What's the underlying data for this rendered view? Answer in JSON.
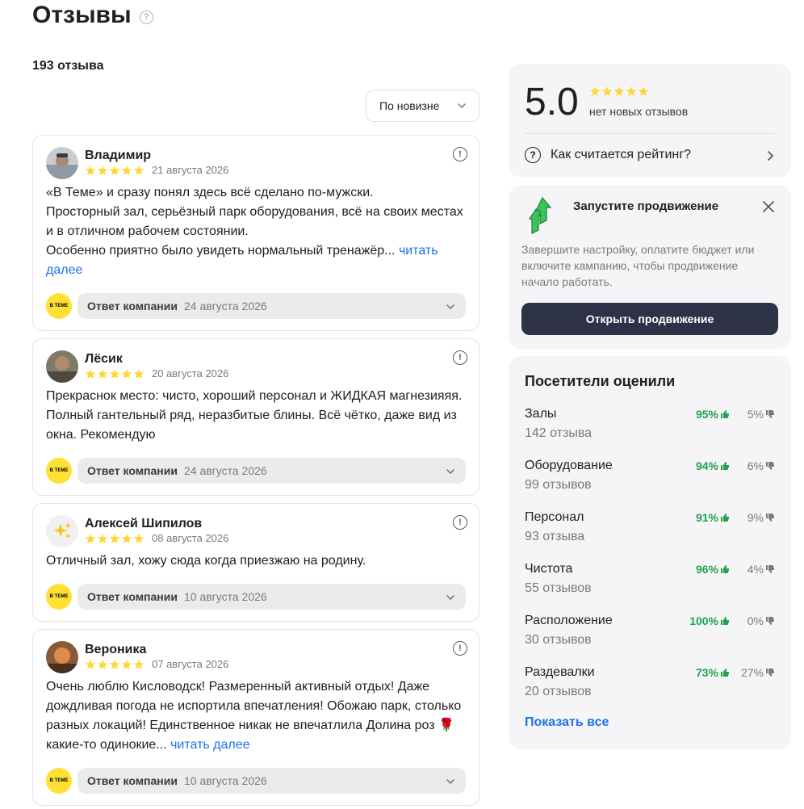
{
  "header": {
    "title": "Отзывы",
    "help_icon": "question-circle-icon",
    "count_label": "193 отзыва"
  },
  "sort": {
    "label": "По новизне"
  },
  "reviews": [
    {
      "author": "Владимир",
      "rating": 5,
      "date": "21 августа 2026",
      "lines": [
        "«В Теме» и сразу понял здесь всё сделано по-мужски.",
        "Просторный зал, серьёзный парк оборудования, всё на своих местах и в отличном рабочем состоянии.",
        "Особенно приятно было увидеть нормальный тренажёр..."
      ],
      "more": "читать далее",
      "reply_label": "Ответ компании",
      "reply_date": "24 августа 2026"
    },
    {
      "author": "Лёсик",
      "rating": 5,
      "date": "20 августа 2026",
      "lines": [
        "Прекраснок место: чисто, хороший персонал и ЖИДКАЯ магнезияяя. Полный гантельный ряд, неразбитые блины. Всё чётко, даже вид из окна. Рекомендую"
      ],
      "more": "",
      "reply_label": "Ответ компании",
      "reply_date": "24 августа 2026"
    },
    {
      "author": "Алексей Шипилов",
      "rating": 5,
      "date": "08 августа 2026",
      "lines": [
        "Отличный зал, хожу сюда когда приезжаю на родину."
      ],
      "more": "",
      "reply_label": "Ответ компании",
      "reply_date": "10 августа 2026"
    },
    {
      "author": "Вероника",
      "rating": 5,
      "date": "07 августа 2026",
      "lines": [
        "Очень люблю Кисловодск! Размеренный активный отдых! Даже дождливая погода не испортила впечатления! Обожаю парк, столько разных локаций! Единственное никак не впечатлила Долина роз 🌹 какие-то одинокие..."
      ],
      "more": "читать далее",
      "reply_label": "Ответ компании",
      "reply_date": "10 августа 2026"
    }
  ],
  "company_logo_text": "В ТЕМЕ",
  "rating_card": {
    "score": "5.0",
    "stars": 5,
    "subtitle": "нет новых отзывов",
    "how_label": "Как считается рейтинг?"
  },
  "promo_card": {
    "title": "Запустите продвижение",
    "text": "Завершите настройку, оплатите бюджет или включите кампанию, чтобы продвижение начало работать.",
    "button": "Открыть продвижение"
  },
  "visitors_card": {
    "title": "Посетители оценили",
    "categories": [
      {
        "name": "Залы",
        "count": "142 отзыва",
        "positive": "95%",
        "negative": "5%"
      },
      {
        "name": "Оборудование",
        "count": "99 отзывов",
        "positive": "94%",
        "negative": "6%"
      },
      {
        "name": "Персонал",
        "count": "93 отзыва",
        "positive": "91%",
        "negative": "9%"
      },
      {
        "name": "Чистота",
        "count": "55 отзывов",
        "positive": "96%",
        "negative": "4%"
      },
      {
        "name": "Расположение",
        "count": "30 отзывов",
        "positive": "100%",
        "negative": "0%"
      },
      {
        "name": "Раздевалки",
        "count": "20 отзывов",
        "positive": "73%",
        "negative": "27%"
      }
    ],
    "show_all": "Показать все"
  },
  "colors": {
    "star": "#fdd835",
    "link": "#1a73e8",
    "positive": "#22a150",
    "button_dark": "#2e3247",
    "card_bg": "#f5f5f7",
    "logo_yellow": "#ffe033"
  }
}
